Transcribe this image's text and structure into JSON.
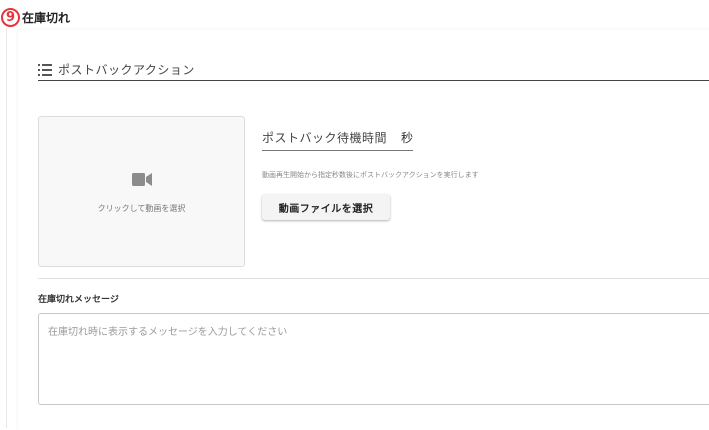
{
  "section": {
    "number": "9",
    "title": "在庫切れ"
  },
  "postback": {
    "header_label": "ポストバックアクション",
    "video_hint": "クリックして動画を選択",
    "wait_label": "ポストバック待機時間",
    "wait_unit": "秒",
    "help_text": "動画再生開始から指定秒数後にポストバックアクションを実行します",
    "file_button_label": "動画ファイルを選択"
  },
  "message": {
    "label": "在庫切れメッセージ",
    "value": "",
    "placeholder": "在庫切れ時に表示するメッセージを入力してください"
  },
  "colors": {
    "accent_badge": "#e8323c",
    "panel_bg": "#f8f8f8"
  },
  "icons": {
    "header": "list-icon",
    "video": "video-camera-icon"
  }
}
